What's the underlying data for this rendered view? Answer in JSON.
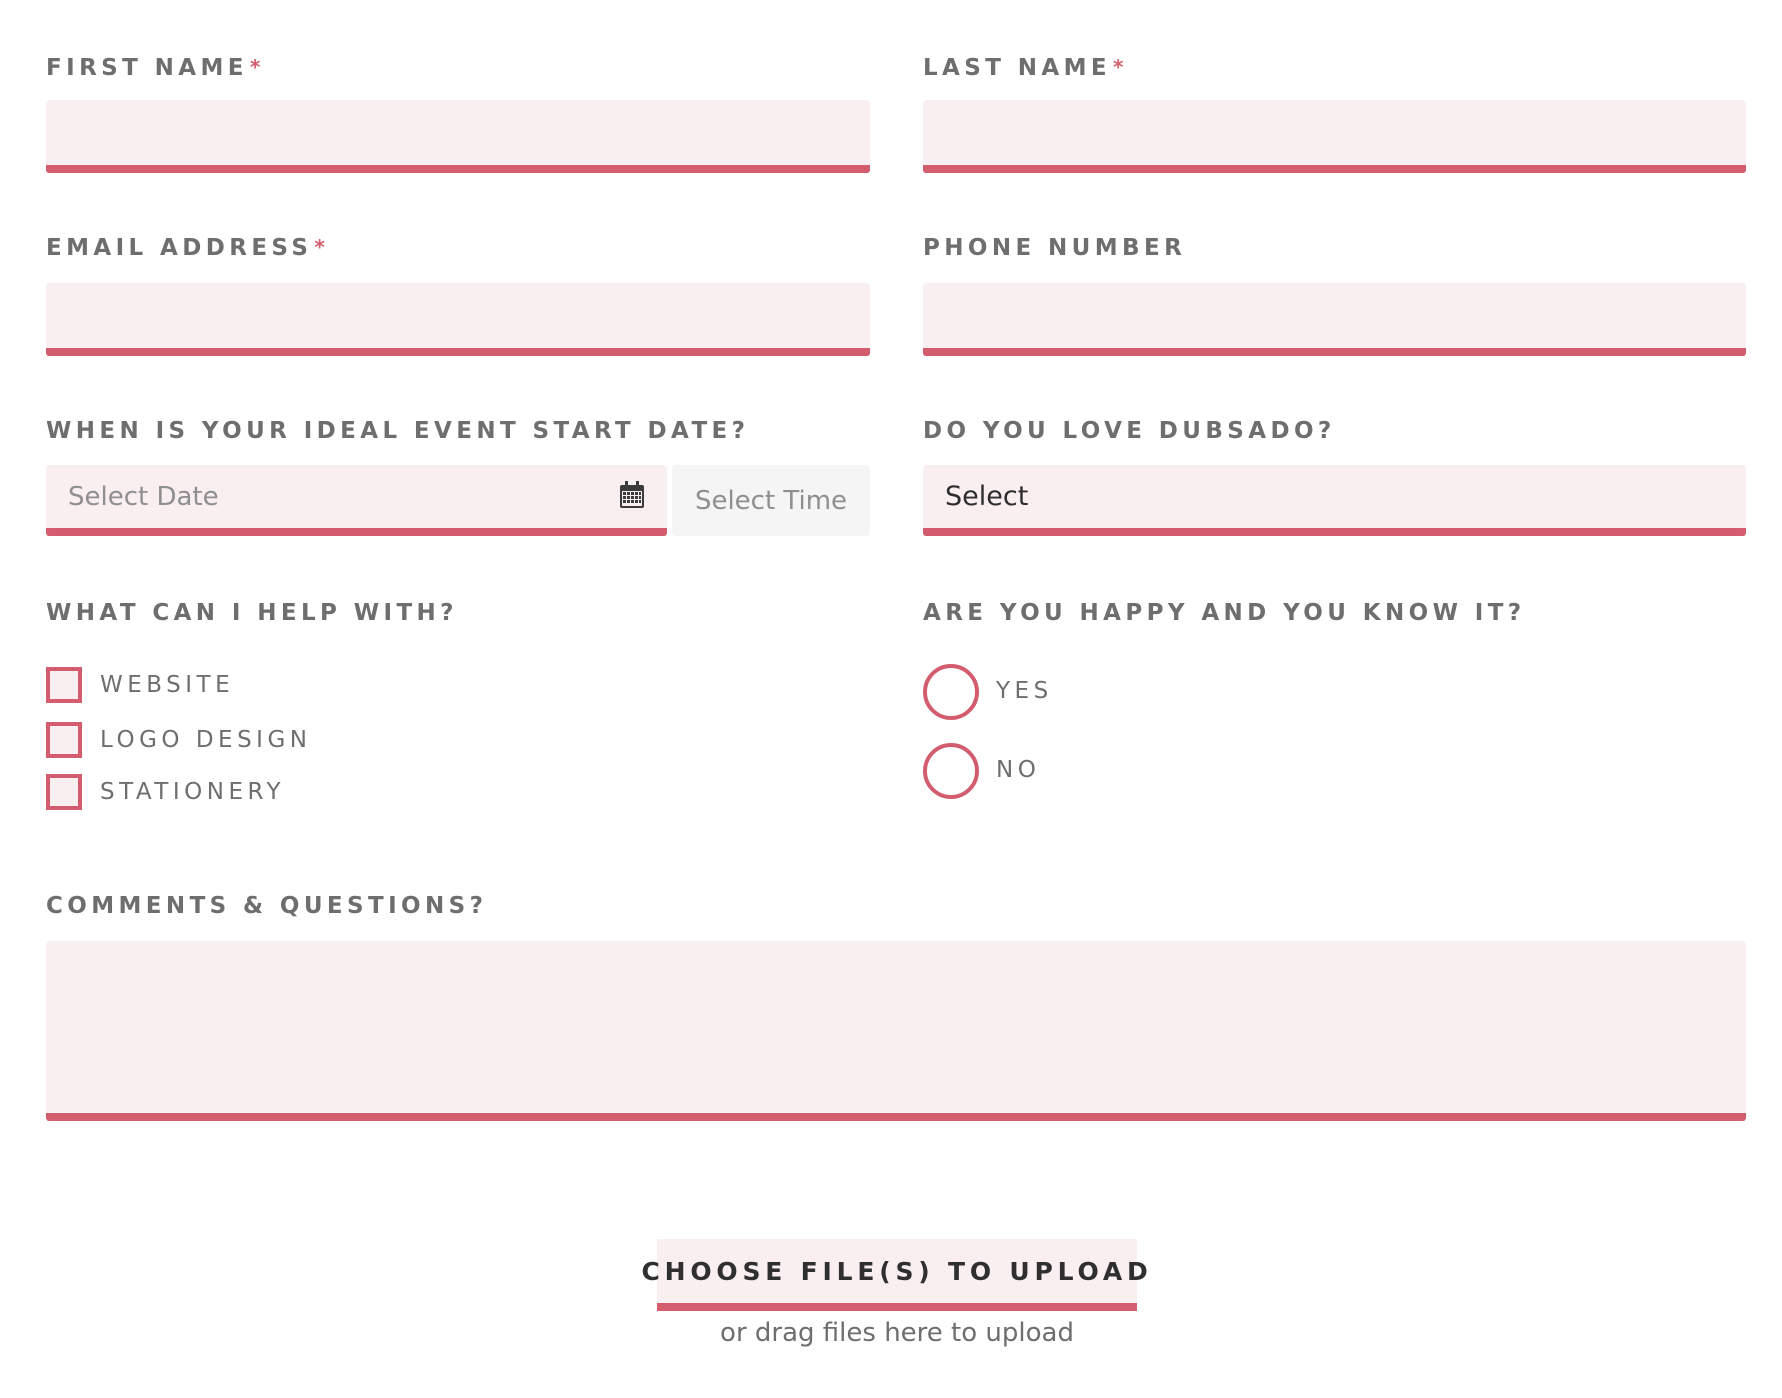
{
  "form": {
    "first_name": {
      "label": "FIRST NAME",
      "required_mark": "*",
      "value": ""
    },
    "last_name": {
      "label": "LAST NAME",
      "required_mark": "*",
      "value": ""
    },
    "email": {
      "label": "EMAIL ADDRESS",
      "required_mark": "*",
      "value": ""
    },
    "phone": {
      "label": "PHONE NUMBER",
      "value": ""
    },
    "event_date": {
      "label": "WHEN IS YOUR IDEAL EVENT START DATE?",
      "date_placeholder": "Select Date",
      "time_placeholder": "Select Time",
      "icon": "calendar-icon"
    },
    "love_dubsado": {
      "label": "DO YOU LOVE DUBSADO?",
      "selected": "Select"
    },
    "help_with": {
      "label": "WHAT CAN I HELP WITH?",
      "options": [
        "WEBSITE",
        "LOGO DESIGN",
        "STATIONERY"
      ]
    },
    "happy": {
      "label": "ARE YOU HAPPY AND YOU KNOW IT?",
      "options": [
        "YES",
        "NO"
      ]
    },
    "comments": {
      "label": "COMMENTS & QUESTIONS?",
      "value": ""
    },
    "upload": {
      "button_label": "CHOOSE FILE(S) TO UPLOAD",
      "hint": "or drag files here to upload"
    }
  },
  "colors": {
    "accent": "#d35d6e",
    "field_bg": "#f9eef0",
    "label_text": "#6e6e6e",
    "time_field_bg": "#f5f5f5"
  }
}
